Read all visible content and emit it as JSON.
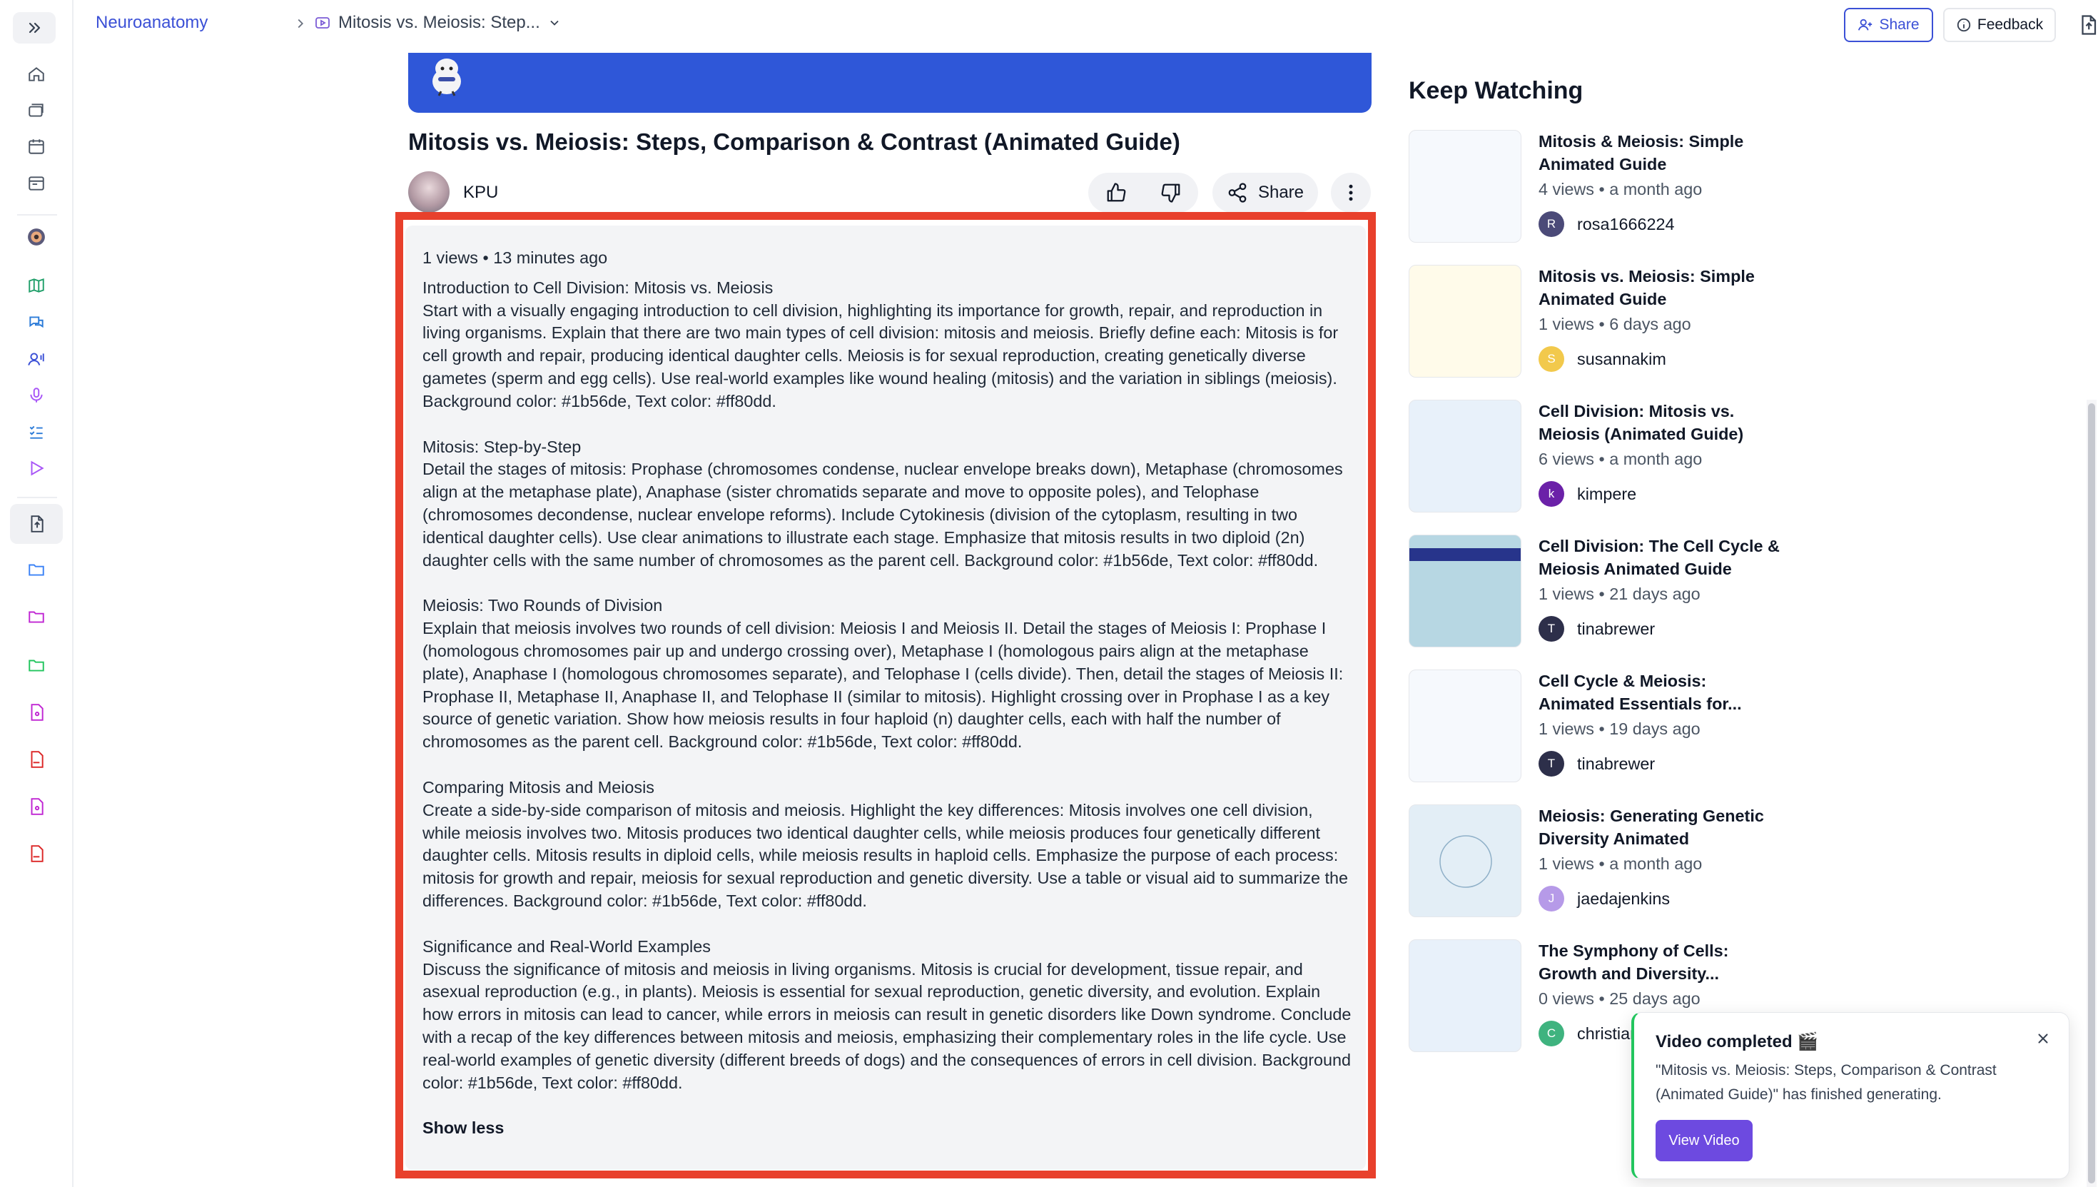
{
  "breadcrumb": {
    "root": "Neuroanatomy",
    "current": "Mitosis vs. Meiosis: Step..."
  },
  "topbar": {
    "share_label": "Share",
    "feedback_label": "Feedback"
  },
  "video": {
    "title": "Mitosis vs. Meiosis: Steps, Comparison & Contrast (Animated Guide)",
    "channel": "KPU",
    "share_label": "Share",
    "views": "1 views",
    "age": "13 minutes ago",
    "show_less": "Show less",
    "sections": [
      {
        "heading": "Introduction to Cell Division: Mitosis vs. Meiosis",
        "body": "Start with a visually engaging introduction to cell division, highlighting its importance for growth, repair, and reproduction in living organisms. Explain that there are two main types of cell division: mitosis and meiosis. Briefly define each: Mitosis is for cell growth and repair, producing identical daughter cells. Meiosis is for sexual reproduction, creating genetically diverse gametes (sperm and egg cells). Use real-world examples like wound healing (mitosis) and the variation in siblings (meiosis). Background color: #1b56de, Text color: #ff80dd."
      },
      {
        "heading": "Mitosis: Step-by-Step",
        "body": "Detail the stages of mitosis: Prophase (chromosomes condense, nuclear envelope breaks down), Metaphase (chromosomes align at the metaphase plate), Anaphase (sister chromatids separate and move to opposite poles), and Telophase (chromosomes decondense, nuclear envelope reforms). Include Cytokinesis (division of the cytoplasm, resulting in two identical daughter cells). Use clear animations to illustrate each stage. Emphasize that mitosis results in two diploid (2n) daughter cells with the same number of chromosomes as the parent cell. Background color: #1b56de, Text color: #ff80dd."
      },
      {
        "heading": "Meiosis: Two Rounds of Division",
        "body": "Explain that meiosis involves two rounds of cell division: Meiosis I and Meiosis II. Detail the stages of Meiosis I: Prophase I (homologous chromosomes pair up and undergo crossing over), Metaphase I (homologous pairs align at the metaphase plate), Anaphase I (homologous chromosomes separate), and Telophase I (cells divide). Then, detail the stages of Meiosis II: Prophase II, Metaphase II, Anaphase II, and Telophase II (similar to mitosis). Highlight crossing over in Prophase I as a key source of genetic variation. Show how meiosis results in four haploid (n) daughter cells, each with half the number of chromosomes as the parent cell. Background color: #1b56de, Text color: #ff80dd."
      },
      {
        "heading": "Comparing Mitosis and Meiosis",
        "body": "Create a side-by-side comparison of mitosis and meiosis. Highlight the key differences: Mitosis involves one cell division, while meiosis involves two. Mitosis produces two identical daughter cells, while meiosis produces four genetically different daughter cells. Mitosis results in diploid cells, while meiosis results in haploid cells. Emphasize the purpose of each process: mitosis for growth and repair, meiosis for sexual reproduction and genetic diversity. Use a table or visual aid to summarize the differences. Background color: #1b56de, Text color: #ff80dd."
      },
      {
        "heading": "Significance and Real-World Examples",
        "body": "Discuss the significance of mitosis and meiosis in living organisms. Mitosis is crucial for development, tissue repair, and asexual reproduction (e.g., in plants). Meiosis is essential for sexual reproduction, genetic diversity, and evolution. Explain how errors in mitosis can lead to cancer, while errors in meiosis can result in genetic disorders like Down syndrome. Conclude with a recap of the key differences between mitosis and meiosis, emphasizing their complementary roles in the life cycle. Use real-world examples of genetic diversity (different breeds of dogs) and the consequences of errors in cell division. Background color: #1b56de, Text color: #ff80dd."
      }
    ]
  },
  "keep_watching": {
    "title": "Keep Watching",
    "items": [
      {
        "title_line1": "Mitosis & Meiosis: Simple",
        "title_line2": "Animated Guide",
        "views": "4 views",
        "age": "a month ago",
        "user": "rosa1666224",
        "initial": "R",
        "avatar_color": "#4b4a78",
        "thumb_bg": "#f6f9fd",
        "thumb_bar": ""
      },
      {
        "title_line1": "Mitosis vs. Meiosis: Simple",
        "title_line2": "Animated Guide",
        "views": "1 views",
        "age": "6 days ago",
        "user": "susannakim",
        "initial": "S",
        "avatar_color": "#f2c94c",
        "thumb_bg": "#fffbea",
        "thumb_bar": ""
      },
      {
        "title_line1": "Cell Division: Mitosis vs.",
        "title_line2": "Meiosis (Animated Guide)",
        "views": "6 views",
        "age": "a month ago",
        "user": "kimpere",
        "initial": "k",
        "avatar_color": "#6b21a8",
        "thumb_bg": "#e8f1fa",
        "thumb_bar": ""
      },
      {
        "title_line1": "Cell Division: The Cell Cycle &",
        "title_line2": "Meiosis Animated Guide",
        "views": "1 views",
        "age": "21 days ago",
        "user": "tinabrewer",
        "initial": "T",
        "avatar_color": "#2d2f4a",
        "thumb_bg": "#b7d7e3",
        "thumb_bar": "#27348b"
      },
      {
        "title_line1": "Cell Cycle & Meiosis:",
        "title_line2": "Animated Essentials for...",
        "views": "1 views",
        "age": "19 days ago",
        "user": "tinabrewer",
        "initial": "T",
        "avatar_color": "#2d2f4a",
        "thumb_bg": "#f6f9fd",
        "thumb_bar": ""
      },
      {
        "title_line1": "Meiosis: Generating Genetic",
        "title_line2": "Diversity Animated",
        "views": "1 views",
        "age": "a month ago",
        "user": "jaedajenkins",
        "initial": "J",
        "avatar_color": "#b69ae8",
        "thumb_bg": "#e3eef6",
        "thumb_bar": ""
      },
      {
        "title_line1": "The Symphony of Cells:",
        "title_line2": "Growth and Diversity...",
        "views": "0 views",
        "age": "25 days ago",
        "user": "christian",
        "initial": "C",
        "avatar_color": "#3fb37f",
        "thumb_bg": "#e8f1fa",
        "thumb_bar": ""
      }
    ]
  },
  "toast": {
    "title": "Video completed 🎬",
    "body": "\"Mitosis vs. Meiosis: Steps, Comparison & Contrast (Animated Guide)\" has finished generating.",
    "button": "View Video"
  },
  "colors": {
    "accent": "#3b50d6",
    "highlight_frame": "#e8402c",
    "banner": "#2f57d8",
    "toast_button": "#6d4ae0"
  }
}
